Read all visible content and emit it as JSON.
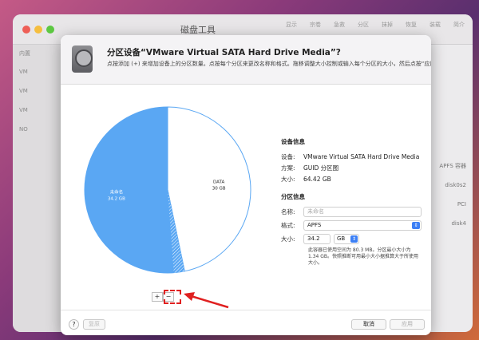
{
  "background": {
    "window_title": "磁盘工具",
    "sidebar_header": "内置",
    "sidebar_items": [
      "VM",
      "VM",
      "VM",
      "NO"
    ],
    "right_labels": [
      "APFS 容器",
      "disk0s2",
      "PCI",
      "disk4"
    ],
    "toolbar": [
      "显示",
      "宗卷",
      "急救",
      "分区",
      "抹掉",
      "恢复",
      "装载",
      "简介"
    ]
  },
  "sheet": {
    "title": "分区设备“VMware Virtual SATA Hard Drive Media”?",
    "description": "点按添加 (+) 来增加设备上的分区数量。点按每个分区来更改名称和格式。拖移调整大小控制或输入每个分区的大小，然后点按“应用”。"
  },
  "chart_data": {
    "type": "pie",
    "slices": [
      {
        "name": "DATA",
        "size_label": "30 GB",
        "value": 30,
        "color": "#ffffff"
      },
      {
        "name": "未命名",
        "size_label": "34.2 GB",
        "value": 34.2,
        "color": "#5aa7f3"
      }
    ],
    "used_hatch_gb": 1.34
  },
  "device_info": {
    "section_title": "设备信息",
    "device_label": "设备:",
    "device_value": "VMware Virtual SATA Hard Drive Media",
    "scheme_label": "方案:",
    "scheme_value": "GUID 分区图",
    "size_label": "大小:",
    "size_value": "64.42 GB"
  },
  "partition_info": {
    "section_title": "分区信息",
    "name_label": "名称:",
    "name_placeholder": "未命名",
    "format_label": "格式:",
    "format_value": "APFS",
    "size_label": "大小:",
    "size_value": "34.2",
    "size_unit": "GB",
    "note": "此容器已使用空间为 80.3 MB。分区最小大小为 1.34 GB。快照推断可用最小大小据推算大于所使用大小。"
  },
  "controls": {
    "plus": "+",
    "minus": "−",
    "help": "?",
    "revert": "复原",
    "cancel": "取消",
    "apply": "应用"
  },
  "colors": {
    "accent": "#3d80f5",
    "slice_blue": "#5aa7f3",
    "annotation_red": "#e02020"
  }
}
